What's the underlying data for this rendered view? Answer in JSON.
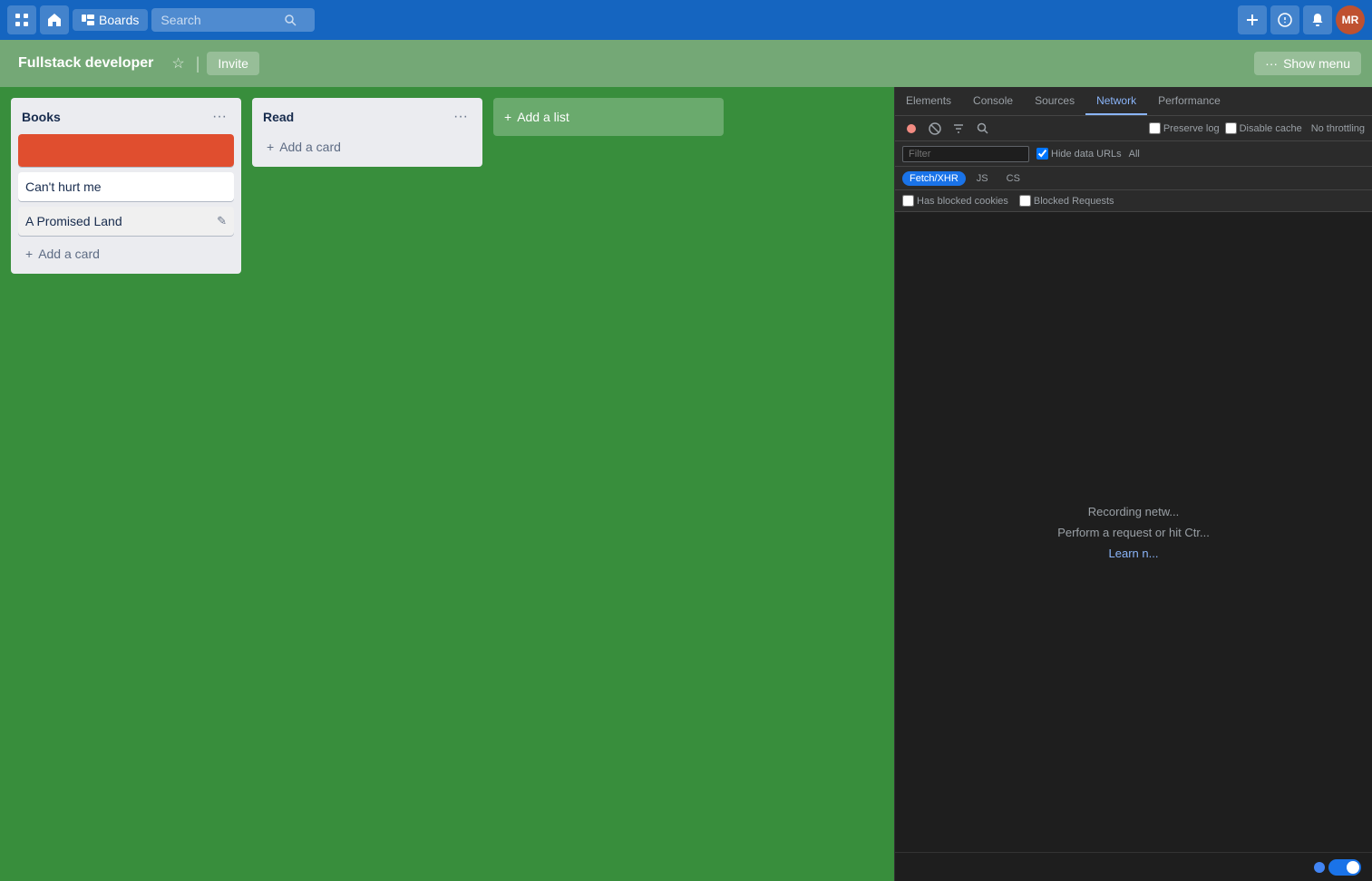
{
  "topNav": {
    "gridIcon": "⊞",
    "homeIcon": "⌂",
    "boardsLabel": "Boards",
    "searchPlaceholder": "Search",
    "searchIcon": "🔍",
    "plusIcon": "+",
    "bellIcon": "🔔",
    "avatarText": "MR"
  },
  "boardHeader": {
    "title": "Fullstack developer",
    "starIcon": "☆",
    "divider": "|",
    "inviteLabel": "Invite",
    "showMenuIcon": "···",
    "showMenuLabel": "Show menu"
  },
  "lists": [
    {
      "id": "books",
      "title": "Books",
      "menuIcon": "···",
      "cards": [
        {
          "id": "card-red",
          "hasRedBanner": true,
          "text": "",
          "showEdit": false
        },
        {
          "id": "card-cant-hurt-me",
          "hasRedBanner": false,
          "text": "Can't hurt me",
          "showEdit": false
        },
        {
          "id": "card-promised-land",
          "hasRedBanner": false,
          "text": "A Promised Land",
          "showEdit": true
        }
      ],
      "addCardLabel": "Add a card",
      "addCardIcon": "+"
    },
    {
      "id": "read",
      "title": "Read",
      "menuIcon": "···",
      "cards": [],
      "addCardLabel": "Add a card",
      "addCardIcon": "+"
    }
  ],
  "addList": {
    "icon": "+",
    "label": "Add a list"
  },
  "devtools": {
    "tabs": [
      {
        "id": "elements",
        "label": "Elements",
        "active": false
      },
      {
        "id": "console",
        "label": "Console",
        "active": false
      },
      {
        "id": "sources",
        "label": "Sources",
        "active": false
      },
      {
        "id": "network",
        "label": "Network",
        "active": true
      },
      {
        "id": "performance",
        "label": "Performance",
        "active": false
      }
    ],
    "toolbar": {
      "recordIcon": "⏺",
      "clearIcon": "🚫",
      "filterIcon": "⊘",
      "searchIcon": "🔍"
    },
    "filterBar": {
      "placeholder": "Filter",
      "hideDataURLs": "Hide data URLs",
      "allLabel": "All",
      "fetchXHRLabel": "Fetch/XHR",
      "jsLabel": "JS",
      "csLabel": "CS"
    },
    "checkboxes": {
      "preserveLog": "Preserve log",
      "disableCache": "Disable cache",
      "noThrottling": "No throttling",
      "hasBlockedCookies": "Has blocked cookies",
      "blockedRequests": "Blocked Requests"
    },
    "contentLines": [
      "Recording netw...",
      "Perform a request or hit Ctr...",
      "Learn n..."
    ]
  },
  "bottomBar": {
    "toggleState": true
  }
}
